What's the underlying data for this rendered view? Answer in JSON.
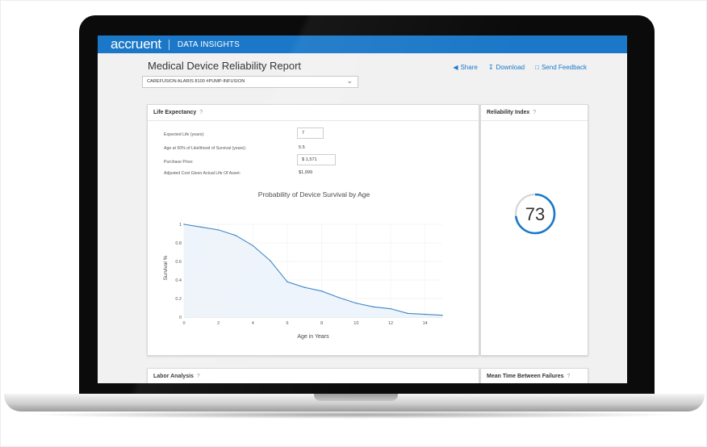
{
  "brand": {
    "logo": "accruent",
    "product": "DATA INSIGHTS"
  },
  "report": {
    "title": "Medical Device Reliability Report",
    "selected_device": "CAREFUSION ALARIS 8100 #PUMP-INFUSION"
  },
  "actions": {
    "share": "Share",
    "download": "Download",
    "feedback": "Send Feedback"
  },
  "icons": {
    "share": "share-icon",
    "download": "download-icon",
    "feedback": "comment-icon",
    "help": "help-circle-icon",
    "dropdown": "chevron-down-icon"
  },
  "life_expectancy": {
    "title": "Life Expectancy",
    "help": "?",
    "expected_life_label": "Expected Life (years):",
    "expected_life_value": "7",
    "age50_label": "Age at 50% of Likelihood of Survival (years):",
    "age50_value": "5.5",
    "purchase_price_label": "Purchase Price:",
    "purchase_price_value": "$ 1,571",
    "adjusted_cost_label": "Adjusted Cost Given Actual Life Of Asset:",
    "adjusted_cost_value": "$1,999"
  },
  "reliability_index": {
    "title": "Reliability Index",
    "help": "?",
    "value": "73",
    "fraction": 0.73
  },
  "labor_analysis": {
    "title": "Labor Analysis",
    "help": "?"
  },
  "mtbf": {
    "title": "Mean Time Between Failures",
    "help": "?"
  },
  "colors": {
    "accent": "#1b78c8",
    "line": "#3d85c6",
    "area": "#eef4fb"
  },
  "chart_data": {
    "type": "area",
    "title": "Probability of Device Survival by Age",
    "xlabel": "Age in Years",
    "ylabel": "Survival %",
    "xlim": [
      0,
      15
    ],
    "ylim": [
      0,
      1
    ],
    "xticks": [
      "0",
      "2",
      "4",
      "6",
      "8",
      "10",
      "12",
      "14"
    ],
    "yticks": [
      "0",
      "0.2",
      "0.4",
      "0.6",
      "0.8",
      "1"
    ],
    "x": [
      0,
      1,
      2,
      3,
      4,
      5,
      6,
      7,
      8,
      9,
      10,
      11,
      12,
      13,
      14,
      15
    ],
    "y": [
      1.0,
      0.97,
      0.94,
      0.88,
      0.77,
      0.61,
      0.38,
      0.32,
      0.28,
      0.21,
      0.15,
      0.11,
      0.09,
      0.04,
      0.03,
      0.02
    ],
    "grid": true
  }
}
